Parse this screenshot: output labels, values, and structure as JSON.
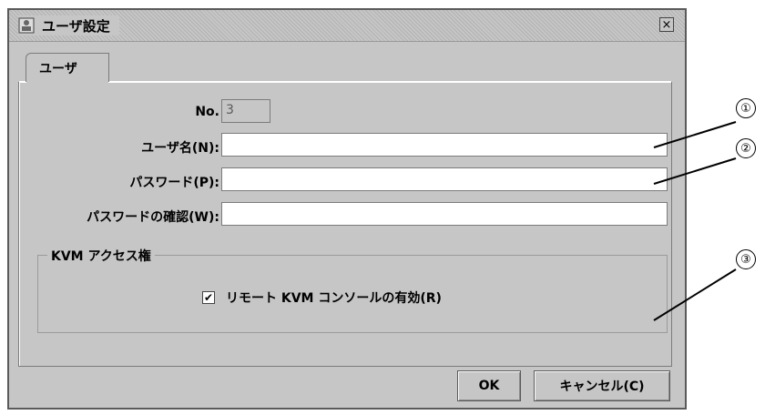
{
  "window": {
    "title": "ユーザ設定",
    "close_icon_glyph": "×"
  },
  "tabs": [
    {
      "label": "ユーザ"
    }
  ],
  "form": {
    "no_label": "No.",
    "no_value": "3",
    "username_label": "ユーザ名(N):",
    "username_value": "",
    "password_label": "パスワード(P):",
    "password_value": "",
    "password_confirm_label": "パスワードの確認(W):",
    "password_confirm_value": ""
  },
  "kvm_group": {
    "label": "KVM アクセス権",
    "checkbox_label": "リモート KVM コンソールの有効(R)",
    "checkbox_checked": true,
    "check_glyph": "✔"
  },
  "buttons": {
    "ok": "OK",
    "cancel": "キャンセル(C)"
  },
  "callouts": [
    "①",
    "②",
    "③"
  ]
}
